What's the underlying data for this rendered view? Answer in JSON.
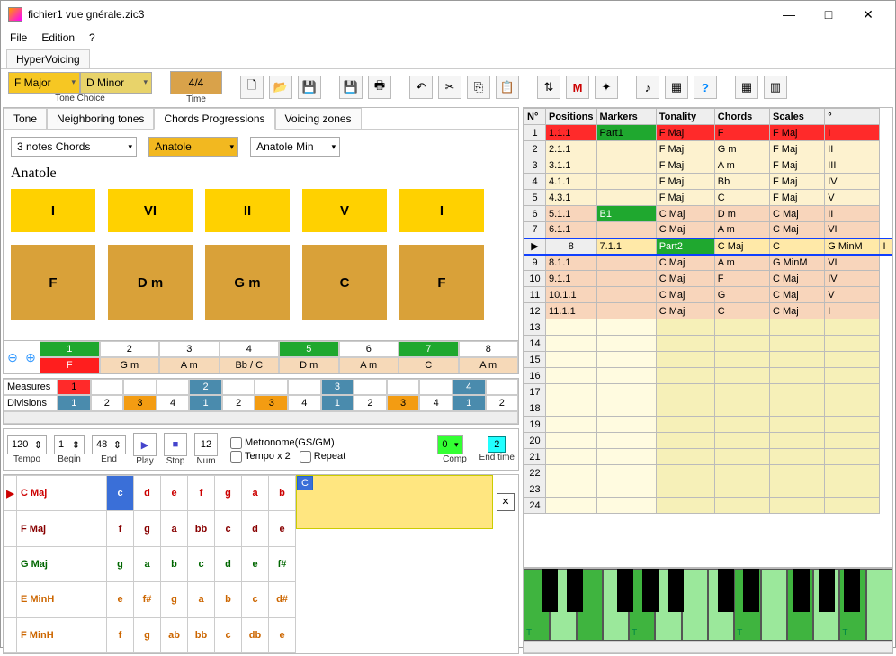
{
  "window": {
    "title": "fichier1 vue gnérale.zic3"
  },
  "menu": {
    "file": "File",
    "edition": "Edition",
    "help": "?"
  },
  "mainTab": "HyperVoicing",
  "toolbar": {
    "key1": "F Major",
    "key2": "D Minor",
    "toneChoice": "Tone Choice",
    "timesig": "4/4",
    "time": "Time"
  },
  "subtabs": {
    "tone": "Tone",
    "neighbor": "Neighboring tones",
    "prog": "Chords Progressions",
    "voicing": "Voicing zones"
  },
  "prog": {
    "chordType": "3 notes Chords",
    "preset1": "Anatole",
    "preset2": "Anatole Min",
    "title": "Anatole",
    "romans": [
      "I",
      "VI",
      "II",
      "V",
      "I"
    ],
    "chords": [
      "F",
      "D m",
      "G m",
      "C",
      "F"
    ]
  },
  "measuresRow": {
    "nums": [
      "1",
      "2",
      "3",
      "4",
      "5",
      "6",
      "7",
      "8"
    ],
    "chords": [
      "F",
      "G m",
      "A m",
      "Bb / C",
      "D m",
      "A m",
      "C",
      "A m"
    ]
  },
  "divpanel": {
    "measuresLabel": "Measures",
    "divisionsLabel": "Divisions",
    "mrow": [
      "1",
      "",
      "",
      "",
      "2",
      "",
      "",
      "",
      "3",
      "",
      "",
      "",
      "4",
      ""
    ],
    "drow": [
      "1",
      "2",
      "3",
      "4",
      "1",
      "2",
      "3",
      "4",
      "1",
      "2",
      "3",
      "4",
      "1",
      "2"
    ]
  },
  "ctrls": {
    "tempo": "120",
    "tempoL": "Tempo",
    "begin": "1",
    "beginL": "Begin",
    "end": "48",
    "endL": "End",
    "playL": "Play",
    "stopL": "Stop",
    "num": "12",
    "numL": "Num",
    "metronome": "Metronome(GS/GM)",
    "tempox2": "Tempo x 2",
    "repeat": "Repeat",
    "comp": "0",
    "compL": "Comp",
    "endtime": "2",
    "endtimeL": "End time"
  },
  "scaleTable": {
    "rows": [
      {
        "name": "C Maj",
        "n": [
          "c",
          "d",
          "e",
          "f",
          "g",
          "a",
          "b"
        ],
        "cls": "r-red",
        "sel": true
      },
      {
        "name": "F Maj",
        "n": [
          "f",
          "g",
          "a",
          "bb",
          "c",
          "d",
          "e"
        ],
        "cls": "r-dred"
      },
      {
        "name": "G Maj",
        "n": [
          "g",
          "a",
          "b",
          "c",
          "d",
          "e",
          "f#"
        ],
        "cls": "r-grn"
      },
      {
        "name": "E MinH",
        "n": [
          "e",
          "f#",
          "g",
          "a",
          "b",
          "c",
          "d#"
        ],
        "cls": "r-or"
      },
      {
        "name": "F MinH",
        "n": [
          "f",
          "g",
          "ab",
          "bb",
          "c",
          "db",
          "e"
        ],
        "cls": "r-or"
      }
    ],
    "cornerChord": "C"
  },
  "rightTable": {
    "headers": [
      "N°",
      "Positions",
      "Markers",
      "Tonality",
      "Chords",
      "Scales",
      "°"
    ],
    "rows": [
      {
        "n": 1,
        "pos": "1.1.1",
        "mark": "Part1",
        "ton": "F Maj",
        "ch": "F",
        "sc": "F Maj",
        "deg": "I",
        "bg": "r",
        "mg": true
      },
      {
        "n": 2,
        "pos": "2.1.1",
        "mark": "",
        "ton": "F Maj",
        "ch": "G m",
        "sc": "F Maj",
        "deg": "II",
        "bg": "y"
      },
      {
        "n": 3,
        "pos": "3.1.1",
        "mark": "",
        "ton": "F Maj",
        "ch": "A m",
        "sc": "F Maj",
        "deg": "III",
        "bg": "y"
      },
      {
        "n": 4,
        "pos": "4.1.1",
        "mark": "",
        "ton": "F Maj",
        "ch": "Bb",
        "sc": "F Maj",
        "deg": "IV",
        "bg": "y"
      },
      {
        "n": 5,
        "pos": "4.3.1",
        "mark": "",
        "ton": "F Maj",
        "ch": "C",
        "sc": "F Maj",
        "deg": "V",
        "bg": "y"
      },
      {
        "n": 6,
        "pos": "5.1.1",
        "mark": "B1",
        "ton": "C Maj",
        "ch": "D m",
        "sc": "C Maj",
        "deg": "II",
        "bg": "p",
        "mg": true
      },
      {
        "n": 7,
        "pos": "6.1.1",
        "mark": "",
        "ton": "C Maj",
        "ch": "A m",
        "sc": "C Maj",
        "deg": "VI",
        "bg": "p"
      },
      {
        "n": 8,
        "pos": "7.1.1",
        "mark": "Part2",
        "ton": "C Maj",
        "ch": "C",
        "sc": "G MinM",
        "deg": "I",
        "bg": "e",
        "mg": true,
        "sel": true
      },
      {
        "n": 9,
        "pos": "8.1.1",
        "mark": "",
        "ton": "C Maj",
        "ch": "A m",
        "sc": "G MinM",
        "deg": "VI",
        "bg": "p"
      },
      {
        "n": 10,
        "pos": "9.1.1",
        "mark": "",
        "ton": "C Maj",
        "ch": "F",
        "sc": "C Maj",
        "deg": "IV",
        "bg": "p"
      },
      {
        "n": 11,
        "pos": "10.1.1",
        "mark": "",
        "ton": "C Maj",
        "ch": "G",
        "sc": "C Maj",
        "deg": "V",
        "bg": "p"
      },
      {
        "n": 12,
        "pos": "11.1.1",
        "mark": "",
        "ton": "C Maj",
        "ch": "C",
        "sc": "C Maj",
        "deg": "I",
        "bg": "p"
      },
      {
        "n": 13,
        "pos": "",
        "mark": "",
        "ton": "",
        "ch": "",
        "sc": "",
        "deg": "",
        "bg": "blank"
      },
      {
        "n": 14,
        "pos": "",
        "mark": "",
        "ton": "",
        "ch": "",
        "sc": "",
        "deg": "",
        "bg": "blank"
      },
      {
        "n": 15,
        "pos": "",
        "mark": "",
        "ton": "",
        "ch": "",
        "sc": "",
        "deg": "",
        "bg": "blank"
      },
      {
        "n": 16,
        "pos": "",
        "mark": "",
        "ton": "",
        "ch": "",
        "sc": "",
        "deg": "",
        "bg": "blank"
      },
      {
        "n": 17,
        "pos": "",
        "mark": "",
        "ton": "",
        "ch": "",
        "sc": "",
        "deg": "",
        "bg": "blank"
      },
      {
        "n": 18,
        "pos": "",
        "mark": "",
        "ton": "",
        "ch": "",
        "sc": "",
        "deg": "",
        "bg": "blank"
      },
      {
        "n": 19,
        "pos": "",
        "mark": "",
        "ton": "",
        "ch": "",
        "sc": "",
        "deg": "",
        "bg": "blank"
      },
      {
        "n": 20,
        "pos": "",
        "mark": "",
        "ton": "",
        "ch": "",
        "sc": "",
        "deg": "",
        "bg": "blank"
      },
      {
        "n": 21,
        "pos": "",
        "mark": "",
        "ton": "",
        "ch": "",
        "sc": "",
        "deg": "",
        "bg": "blank"
      },
      {
        "n": 22,
        "pos": "",
        "mark": "",
        "ton": "",
        "ch": "",
        "sc": "",
        "deg": "",
        "bg": "blank"
      },
      {
        "n": 23,
        "pos": "",
        "mark": "",
        "ton": "",
        "ch": "",
        "sc": "",
        "deg": "",
        "bg": "blank"
      },
      {
        "n": 24,
        "pos": "",
        "mark": "",
        "ton": "",
        "ch": "",
        "sc": "",
        "deg": "",
        "bg": "blank"
      }
    ]
  },
  "piano": {
    "letters": [
      "T",
      "T",
      "T"
    ],
    "onKeys": [
      0,
      2,
      4,
      8,
      10,
      12
    ]
  }
}
